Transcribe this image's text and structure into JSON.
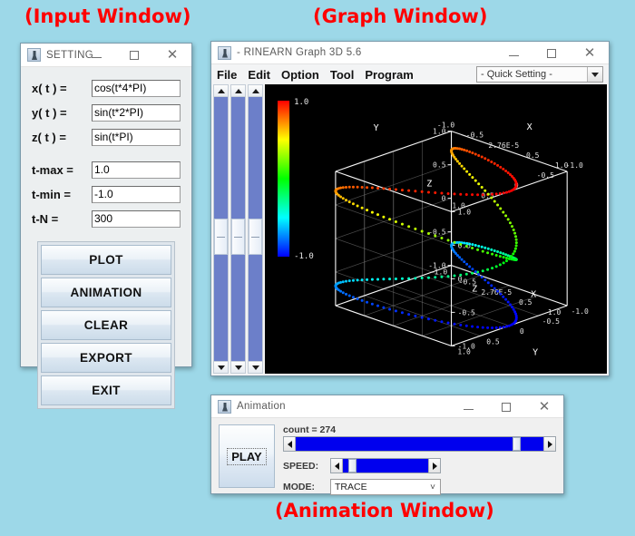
{
  "captions": {
    "input": "(Input Window)",
    "graph": "(Graph Window)",
    "animation": "(Animation Window)"
  },
  "colors": {
    "background": "#9dd8e8",
    "caption": "#ff0000",
    "canvas": "#000000",
    "scrollbar_track": "#6c7fc9",
    "slider_fill": "#0000ee"
  },
  "setting_window": {
    "title": "SETTING",
    "icon": "java-coffee-icon",
    "window_buttons": [
      "minimize",
      "maximize",
      "close"
    ],
    "fields": [
      {
        "label": "x( t ) =",
        "value": "cos(t*4*PI)"
      },
      {
        "label": "y( t ) =",
        "value": "sin(t*2*PI)"
      },
      {
        "label": "z( t ) =",
        "value": "sin(t*PI)"
      },
      {
        "label": "t-max =",
        "value": "1.0"
      },
      {
        "label": "t-min =",
        "value": "-1.0"
      },
      {
        "label": "t-N =",
        "value": "300"
      }
    ],
    "buttons": [
      "PLOT",
      "ANIMATION",
      "CLEAR",
      "EXPORT",
      "EXIT"
    ]
  },
  "graph_window": {
    "title": "- RINEARN Graph 3D 5.6",
    "icon": "java-coffee-icon",
    "window_buttons": [
      "minimize",
      "maximize",
      "close"
    ],
    "menu": [
      "File",
      "Edit",
      "Option",
      "Tool",
      "Program"
    ],
    "quick_setting": {
      "value": "- Quick Setting -"
    },
    "scrollbars": 3
  },
  "animation_window": {
    "title": "Animation",
    "icon": "java-coffee-icon",
    "window_buttons": [
      "minimize",
      "maximize",
      "close"
    ],
    "play_label": "PLAY",
    "count_label": "count = 274",
    "count_position_pct": 91,
    "speed_label": "SPEED:",
    "speed_position_pct": 6,
    "mode_label": "MODE:",
    "mode_value": "TRACE"
  },
  "chart_data": {
    "type": "scatter",
    "title": "",
    "xlabel": "X",
    "ylabel": "Y",
    "zlabel": "Z",
    "parametric": {
      "x": "cos(t*4*PI)",
      "y": "sin(t*2*PI)",
      "z": "sin(t*PI)",
      "t_min": -1.0,
      "t_max": 1.0,
      "t_n": 300
    },
    "xlim": [
      -1.0,
      1.0
    ],
    "ylim": [
      -1.0,
      1.0
    ],
    "zlim": [
      -1.0,
      1.0
    ],
    "x_ticks": [
      "-1.0",
      "-0.5",
      "2.76E-5",
      "0.5",
      "1.0"
    ],
    "y_ticks": [
      "-1.0",
      "-0.5",
      "0",
      "0.5",
      "1.0"
    ],
    "z_ticks": [
      "-1.0",
      "-0.5",
      "0",
      "0.5",
      "1.0"
    ],
    "colorbar": {
      "max": "1.0",
      "min": "-1.0",
      "gradient": [
        "#ff0000",
        "#ffff00",
        "#00ff00",
        "#00ffff",
        "#0000ff"
      ]
    },
    "grid": true,
    "legend": "none",
    "point_count": 300,
    "background": "#000000"
  }
}
